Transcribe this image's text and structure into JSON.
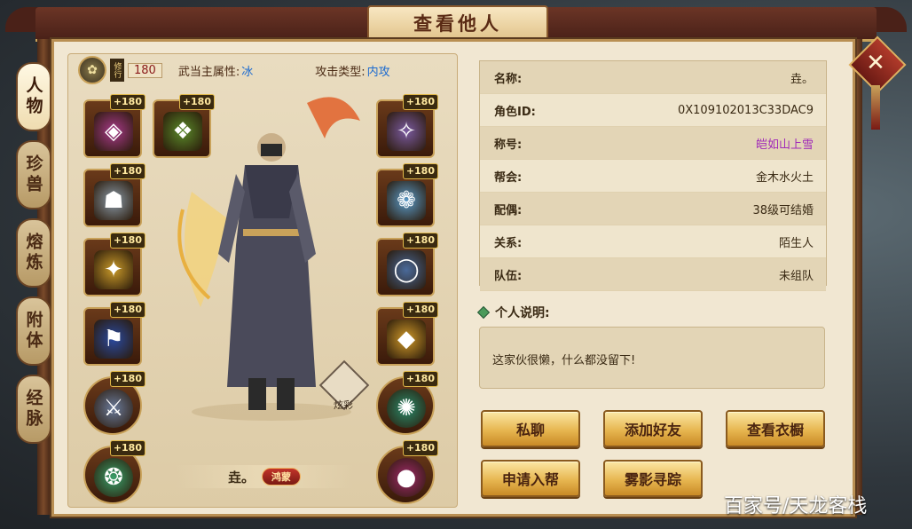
{
  "window": {
    "title": "查看他人",
    "close_icon_label": "✕"
  },
  "side_tabs": [
    {
      "label": "人物",
      "active": true
    },
    {
      "label": "珍兽",
      "active": false
    },
    {
      "label": "熔炼",
      "active": false
    },
    {
      "label": "附体",
      "active": false
    },
    {
      "label": "经脉",
      "active": false
    }
  ],
  "character": {
    "cultivation_tag": "修行",
    "cultivation_value": "180",
    "main_attr_label": "武当主属性:",
    "main_attr_value": "冰",
    "attack_type_label": "攻击类型:",
    "attack_type_value": "内攻",
    "name": "垚。",
    "title_badge": "鸿蒙",
    "skin_label": "炫彩"
  },
  "equipment_left": [
    {
      "level": "+180",
      "icon": "bracer-icon",
      "color": "#a83a8a",
      "glyph": "◈"
    },
    {
      "level": "+180",
      "icon": "seal-icon",
      "color": "#5a8a2a",
      "glyph": "❖"
    },
    {
      "level": "+180",
      "icon": "helmet-icon",
      "color": "#8a9aa8",
      "glyph": "☗"
    },
    {
      "level": "+180",
      "icon": "shoulder-icon",
      "color": "#c99a2a",
      "glyph": "✦"
    },
    {
      "level": "+180",
      "icon": "boots-icon",
      "color": "#2a4aa0",
      "glyph": "⚑"
    },
    {
      "level": "+180",
      "icon": "weapon-icon",
      "color": "#6a7a9a",
      "glyph": "⚔"
    },
    {
      "level": "+180",
      "icon": "jade-icon",
      "color": "#3aa06a",
      "glyph": "❂"
    }
  ],
  "equipment_right": [
    {
      "level": "+180",
      "icon": "sleeve-icon",
      "color": "#7a5aa0",
      "glyph": "✧"
    },
    {
      "level": "+180",
      "icon": "necklace-icon",
      "color": "#5a9ac8",
      "glyph": "❁"
    },
    {
      "level": "+180",
      "icon": "ring-icon",
      "color": "#4a6a9a",
      "glyph": "◯"
    },
    {
      "level": "+180",
      "icon": "armor-icon",
      "color": "#d09a2a",
      "glyph": "◆"
    },
    {
      "level": "+180",
      "icon": "amulet-icon",
      "color": "#2a8a6a",
      "glyph": "✺"
    },
    {
      "level": "+180",
      "icon": "orb-icon",
      "color": "#a02a6a",
      "glyph": "●"
    }
  ],
  "info": [
    {
      "key": "名称:",
      "value": "垚。",
      "color": "#3a2a14"
    },
    {
      "key": "角色ID:",
      "value": "0X109102013C33DAC9",
      "color": "#3a2a14"
    },
    {
      "key": "称号:",
      "value": "皑如山上雪",
      "color": "#a02ab8"
    },
    {
      "key": "帮会:",
      "value": "金木水火土",
      "color": "#3a2a14"
    },
    {
      "key": "配偶:",
      "value": "38级可结婚",
      "color": "#3a2a14"
    },
    {
      "key": "关系:",
      "value": "陌生人",
      "color": "#3a2a14"
    },
    {
      "key": "队伍:",
      "value": "未组队",
      "color": "#3a2a14"
    }
  ],
  "description": {
    "heading": "个人说明:",
    "text": "这家伙很懒，什么都没留下!"
  },
  "buttons": {
    "private_chat": "私聊",
    "add_friend": "添加好友",
    "view_wardrobe": "查看衣橱",
    "join_guild": "申请入帮",
    "trace": "雾影寻踪"
  },
  "watermark": "百家号/天龙客栈"
}
